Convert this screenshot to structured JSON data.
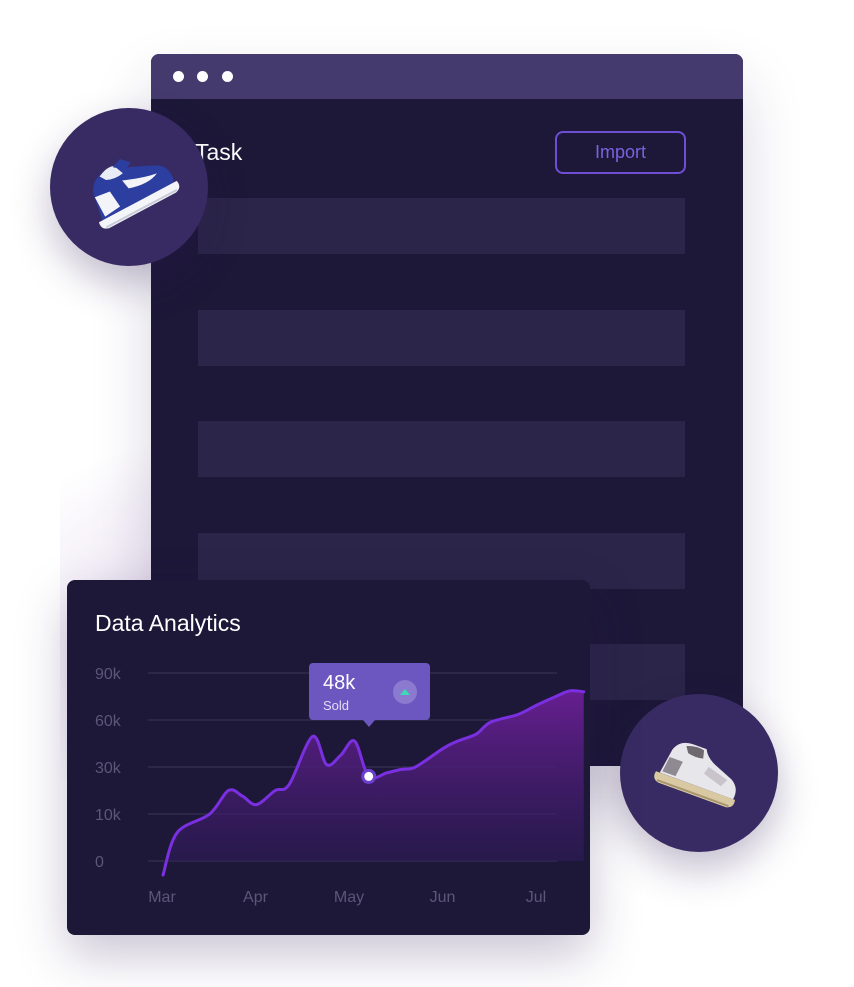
{
  "window": {
    "title": "Task",
    "import_label": "Import"
  },
  "analytics": {
    "title": "Data Analytics",
    "tooltip": {
      "value": "48k",
      "label": "Sold"
    }
  },
  "icons": {
    "window_dots": "dot-icon",
    "top_product": "sneaker-icon",
    "bottom_product": "sneaker-icon",
    "tooltip_badge": "triangle-up-icon"
  },
  "colors": {
    "background": "#ffffff",
    "panel": "#1d1838",
    "titlebar": "#443a6e",
    "row": "#2b2549",
    "accent": "#6e4fd3",
    "line": "#7a2fe0",
    "tooltip": "#6c57c0",
    "badge_arrow": "#3ed8b4"
  },
  "chart_data": {
    "type": "area",
    "title": "Data Analytics",
    "categories": [
      "Mar",
      "Apr",
      "May",
      "Jun",
      "Jul"
    ],
    "y_tick_labels": [
      "0",
      "10k",
      "30k",
      "60k",
      "90k"
    ],
    "x": [
      0,
      0.15,
      0.5,
      0.7,
      0.85,
      1.0,
      1.2,
      1.35,
      1.6,
      1.75,
      1.9,
      2.05,
      2.2,
      2.4,
      2.55,
      2.7,
      3.0,
      3.15,
      3.35,
      3.5,
      3.8,
      4.0,
      4.2,
      4.35,
      4.5
    ],
    "y_position": [
      -0.3,
      0.6,
      1.0,
      1.5,
      1.38,
      1.2,
      1.5,
      1.63,
      2.65,
      2.05,
      2.25,
      2.55,
      1.8,
      1.88,
      1.95,
      2.0,
      2.4,
      2.55,
      2.7,
      2.95,
      3.12,
      3.32,
      3.5,
      3.62,
      3.6
    ],
    "highlight": {
      "x": 2.2,
      "label": "48k",
      "sublabel": "Sold"
    },
    "grid": true,
    "legend": "none"
  }
}
